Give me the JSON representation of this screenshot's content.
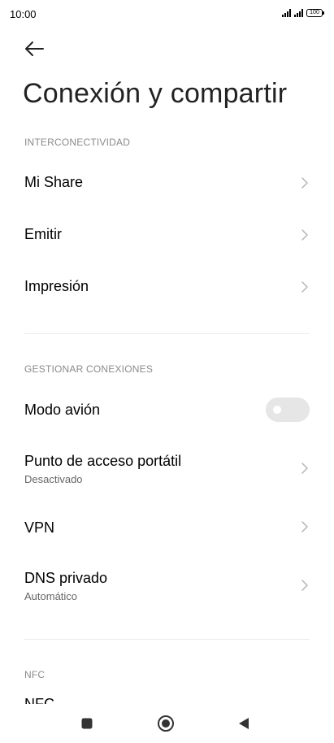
{
  "status_bar": {
    "time": "10:00",
    "battery": "100"
  },
  "header": {
    "title": "Conexión y compartir"
  },
  "sections": {
    "interconnectivity": {
      "header": "INTERCONECTIVIDAD",
      "items": [
        {
          "label": "Mi Share"
        },
        {
          "label": "Emitir"
        },
        {
          "label": "Impresión"
        }
      ]
    },
    "connections": {
      "header": "GESTIONAR CONEXIONES",
      "airplane": {
        "label": "Modo avión",
        "enabled": false
      },
      "hotspot": {
        "label": "Punto de acceso portátil",
        "subtitle": "Desactivado"
      },
      "vpn": {
        "label": "VPN"
      },
      "dns": {
        "label": "DNS privado",
        "subtitle": "Automático"
      }
    },
    "nfc": {
      "header": "NFC",
      "item_label": "NFC"
    }
  },
  "colors": {
    "section_header": "#8a8a8a",
    "divider": "#ececec",
    "toggle_off": "#e6e6e6",
    "chevron": "#b5b5b5"
  }
}
